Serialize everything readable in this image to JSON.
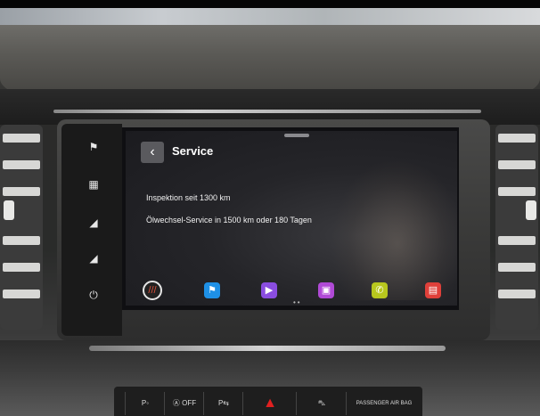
{
  "screen": {
    "title": "Service",
    "back_icon": "‹",
    "lines": [
      "Inspektion seit 1300 km",
      "Ölwechsel-Service in 1500 km oder 180 Tagen"
    ],
    "dock": [
      {
        "name": "navigation-icon",
        "glyph": "⚑",
        "color": "#1e90e6"
      },
      {
        "name": "media-icon",
        "glyph": "▶",
        "color": "#8a4de0"
      },
      {
        "name": "radio-icon",
        "glyph": "▣",
        "color": "#b04ad6"
      },
      {
        "name": "phone-icon",
        "glyph": "✆",
        "color": "#b8c71e"
      },
      {
        "name": "car-menu-icon",
        "glyph": "▤",
        "color": "#e0403a"
      }
    ]
  },
  "controls": {
    "passenger_airbag": "PASSENGER AIR BAG",
    "off_label": "OFF"
  }
}
